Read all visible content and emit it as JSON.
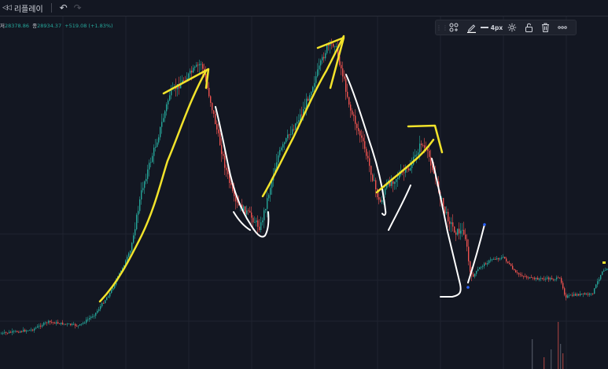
{
  "topbar": {
    "replay_label": "리플레이",
    "replay_icon": "replay-icon",
    "undo_icon": "undo-icon",
    "redo_icon": "redo-icon"
  },
  "legend": {
    "label_low": "저",
    "low": "28378.86",
    "label_close": "종",
    "close": "28934.37",
    "change": "+519.08 (+1.83%)",
    "color": "#26a69a"
  },
  "drawing_toolbar": {
    "stroke_width_label": "4px",
    "tools": [
      "grip-icon",
      "group-icon",
      "pen-color-icon",
      "line-width-icon",
      "settings-icon",
      "unlock-icon",
      "trash-icon",
      "more-icon"
    ]
  },
  "colors": {
    "background": "#131722",
    "candle_up": "#26a69a",
    "candle_down": "#ef5350",
    "drawing_yellow": "#f2e32b",
    "drawing_white": "#ffffff"
  }
}
